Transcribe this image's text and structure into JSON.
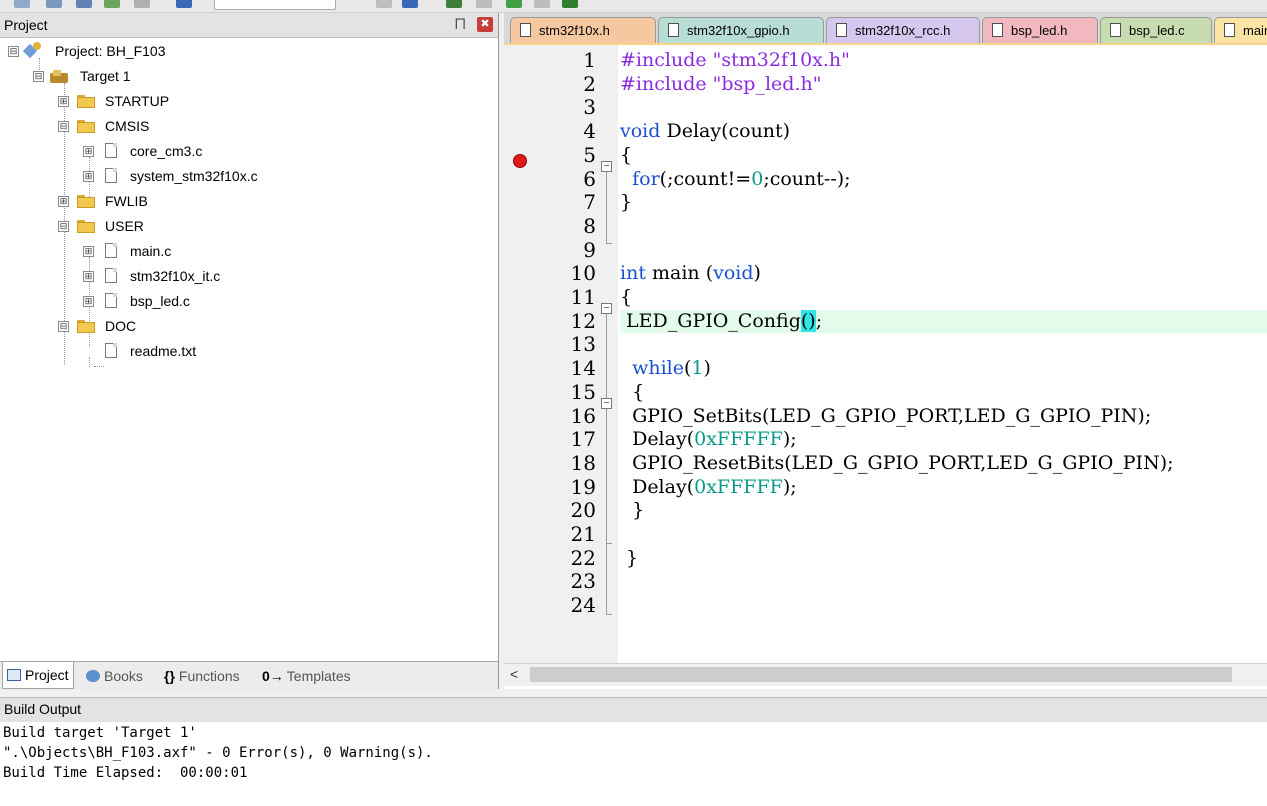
{
  "project_panel": {
    "title": "Project",
    "pin_glyph": "⨅",
    "close_glyph": "✖",
    "tree": [
      {
        "label": "Project: BH_F103",
        "kind": "project",
        "expander": "⊟"
      },
      {
        "label": "Target 1",
        "kind": "target",
        "expander": "⊟"
      },
      {
        "label": "STARTUP",
        "kind": "folder",
        "expander": "⊞"
      },
      {
        "label": "CMSIS",
        "kind": "folder",
        "expander": "⊟"
      },
      {
        "label": "core_cm3.c",
        "kind": "file",
        "expander": "⊞"
      },
      {
        "label": "system_stm32f10x.c",
        "kind": "file",
        "expander": "⊞"
      },
      {
        "label": "FWLIB",
        "kind": "folder",
        "expander": "⊞"
      },
      {
        "label": "USER",
        "kind": "folder",
        "expander": "⊟"
      },
      {
        "label": "main.c",
        "kind": "file",
        "expander": "⊞"
      },
      {
        "label": "stm32f10x_it.c",
        "kind": "file",
        "expander": "⊞"
      },
      {
        "label": "bsp_led.c",
        "kind": "file",
        "expander": "⊞"
      },
      {
        "label": "DOC",
        "kind": "folder",
        "expander": "⊟"
      },
      {
        "label": "readme.txt",
        "kind": "file",
        "expander": ""
      }
    ],
    "tabs": [
      {
        "label": "Project",
        "icon": "project-window-icon",
        "active": true
      },
      {
        "label": "Books",
        "icon": "books-icon",
        "active": false
      },
      {
        "label": "Functions",
        "icon": "functions-icon",
        "active": false
      },
      {
        "label": "Templates",
        "icon": "templates-icon",
        "active": false
      }
    ],
    "functions_glyph": "{}",
    "templates_glyph": "0→"
  },
  "editor": {
    "tabs": [
      {
        "label": "stm32f10x.h",
        "color": "#f5c8a0"
      },
      {
        "label": "stm32f10x_gpio.h",
        "color": "#b7ddd4"
      },
      {
        "label": "stm32f10x_rcc.h",
        "color": "#d6c7ee"
      },
      {
        "label": "bsp_led.h",
        "color": "#f2b8c0"
      },
      {
        "label": "bsp_led.c",
        "color": "#c7dcb0"
      },
      {
        "label": "main.c",
        "color": "#fbe3a3",
        "active": true
      }
    ],
    "breakpoint_line": 4,
    "highlight_line": 12,
    "line_numbers": [
      "1",
      "2",
      "3",
      "4",
      "5",
      "6",
      "7",
      "8",
      "9",
      "10",
      "11",
      "12",
      "13",
      "14",
      "15",
      "16",
      "17",
      "18",
      "19",
      "20",
      "21",
      "22",
      "23",
      "24"
    ],
    "fold_glyph": "−",
    "code_lines": [
      [
        {
          "t": "#include ",
          "c": "str"
        },
        {
          "t": "\"stm32f10x.h\"",
          "c": "str"
        }
      ],
      [
        {
          "t": "#include ",
          "c": "str"
        },
        {
          "t": "\"bsp_led.h\"",
          "c": "str"
        }
      ],
      [],
      [
        {
          "t": "void",
          "c": "kw"
        },
        {
          "t": " Delay(count)",
          "c": ""
        }
      ],
      [
        {
          "t": "{",
          "c": ""
        }
      ],
      [
        {
          "t": "  ",
          "c": ""
        },
        {
          "t": "for",
          "c": "kw"
        },
        {
          "t": "(;count!=",
          "c": ""
        },
        {
          "t": "0",
          "c": "num"
        },
        {
          "t": ";count--);",
          "c": ""
        }
      ],
      [
        {
          "t": "}",
          "c": ""
        }
      ],
      [],
      [],
      [
        {
          "t": "int",
          "c": "kw"
        },
        {
          "t": " main (",
          "c": ""
        },
        {
          "t": "void",
          "c": "kw"
        },
        {
          "t": ")",
          "c": ""
        }
      ],
      [
        {
          "t": "{",
          "c": ""
        }
      ],
      [
        {
          "t": " LED_GPIO_Config",
          "c": ""
        },
        {
          "t": "()",
          "c": "paren-match"
        },
        {
          "t": ";",
          "c": ""
        }
      ],
      [],
      [
        {
          "t": "  ",
          "c": ""
        },
        {
          "t": "while",
          "c": "kw"
        },
        {
          "t": "(",
          "c": ""
        },
        {
          "t": "1",
          "c": "num"
        },
        {
          "t": ")",
          "c": ""
        }
      ],
      [
        {
          "t": "  {",
          "c": ""
        }
      ],
      [
        {
          "t": "  GPIO_SetBits(LED_G_GPIO_PORT,LED_G_GPIO_PIN);",
          "c": ""
        }
      ],
      [
        {
          "t": "  Delay(",
          "c": ""
        },
        {
          "t": "0xFFFFF",
          "c": "num"
        },
        {
          "t": ");",
          "c": ""
        }
      ],
      [
        {
          "t": "  GPIO_ResetBits(LED_G_GPIO_PORT,LED_G_GPIO_PIN);",
          "c": ""
        }
      ],
      [
        {
          "t": "  Delay(",
          "c": ""
        },
        {
          "t": "0xFFFFF",
          "c": "num"
        },
        {
          "t": ");",
          "c": ""
        }
      ],
      [
        {
          "t": "  }",
          "c": ""
        }
      ],
      [],
      [
        {
          "t": " }",
          "c": ""
        }
      ],
      [],
      []
    ],
    "scroll_left_glyph": "<"
  },
  "build_output": {
    "title": "Build Output",
    "lines": [
      "Build target 'Target 1'",
      "\".\\Objects\\BH_F103.axf\" - 0 Error(s), 0 Warning(s).",
      "Build Time Elapsed:  00:00:01"
    ]
  }
}
